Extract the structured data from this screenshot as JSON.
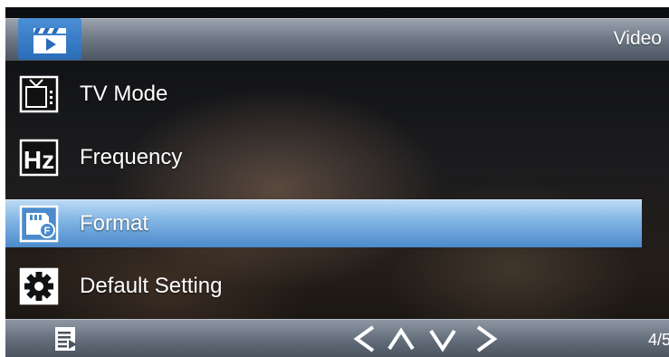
{
  "header": {
    "mode_icon": "video-clapper-icon",
    "title": "Video"
  },
  "menu": {
    "items": [
      {
        "label": "TV Mode",
        "icon": "tv-icon",
        "selected": false
      },
      {
        "label": "Frequency",
        "icon": "hz-icon",
        "selected": false
      },
      {
        "label": "Format",
        "icon": "sd-card-format-icon",
        "selected": true
      },
      {
        "label": "Default Setting",
        "icon": "gear-icon",
        "selected": false
      }
    ]
  },
  "footer": {
    "menu_icon": "menu-list-icon",
    "nav_icons": [
      "chevron-left-icon",
      "chevron-up-icon",
      "chevron-down-icon",
      "chevron-right-icon"
    ],
    "page_indicator": "4/5"
  },
  "colors": {
    "selected_highlight": "#7fb3e3",
    "mode_icon_bg": "#2a6cb8"
  }
}
